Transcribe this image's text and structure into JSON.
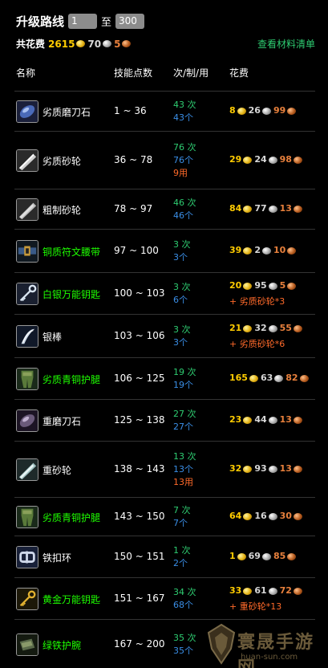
{
  "header": {
    "title": "升级路线",
    "from": "1",
    "to_label": "至",
    "to": "300"
  },
  "totals": {
    "label": "共花费",
    "gold": "2615",
    "silver": "70",
    "copper": "5"
  },
  "mats_link": "查看材料清单",
  "columns": {
    "name": "名称",
    "points": "技能点数",
    "times": "次/制/用",
    "cost": "花费"
  },
  "rows": [
    {
      "name": "劣质磨刀石",
      "name_green": false,
      "icon": "rough-sharpening-stone-icon",
      "range": "1 ~ 36",
      "t1": "43 次",
      "t2": "43个",
      "t3": "",
      "gold": "8",
      "silver": "26",
      "copper": "99",
      "extra": ""
    },
    {
      "name": "劣质砂轮",
      "name_green": false,
      "icon": "rough-grinding-stone-icon",
      "range": "36 ~ 78",
      "t1": "76 次",
      "t2": "76个",
      "t3": "9用",
      "gold": "29",
      "silver": "24",
      "copper": "98",
      "extra": ""
    },
    {
      "name": "粗制砂轮",
      "name_green": false,
      "icon": "coarse-grinding-stone-icon",
      "range": "78 ~ 97",
      "t1": "46 次",
      "t2": "46个",
      "t3": "",
      "gold": "84",
      "silver": "77",
      "copper": "13",
      "extra": ""
    },
    {
      "name": "铜质符文腰带",
      "name_green": true,
      "icon": "runed-copper-belt-icon",
      "range": "97 ~ 100",
      "t1": "3 次",
      "t2": "3个",
      "t3": "",
      "gold": "39",
      "silver": "2",
      "copper": "10",
      "extra": ""
    },
    {
      "name": "白银万能钥匙",
      "name_green": true,
      "icon": "silver-skeleton-key-icon",
      "range": "100 ~ 103",
      "t1": "3 次",
      "t2": "6个",
      "t3": "",
      "gold": "20",
      "silver": "95",
      "copper": "5",
      "extra": "+ 劣质砂轮*3"
    },
    {
      "name": "银棒",
      "name_green": false,
      "icon": "silver-rod-icon",
      "range": "103 ~ 106",
      "t1": "3 次",
      "t2": "3个",
      "t3": "",
      "gold": "21",
      "silver": "32",
      "copper": "55",
      "extra": "+ 劣质砂轮*6"
    },
    {
      "name": "劣质青铜护腿",
      "name_green": true,
      "icon": "rough-bronze-leggings-icon",
      "range": "106 ~ 125",
      "t1": "19 次",
      "t2": "19个",
      "t3": "",
      "gold": "165",
      "silver": "63",
      "copper": "82",
      "extra": ""
    },
    {
      "name": "重磨刀石",
      "name_green": false,
      "icon": "heavy-sharpening-stone-icon",
      "range": "125 ~ 138",
      "t1": "27 次",
      "t2": "27个",
      "t3": "",
      "gold": "23",
      "silver": "44",
      "copper": "13",
      "extra": ""
    },
    {
      "name": "重砂轮",
      "name_green": false,
      "icon": "heavy-grinding-stone-icon",
      "range": "138 ~ 143",
      "t1": "13 次",
      "t2": "13个",
      "t3": "13用",
      "gold": "32",
      "silver": "93",
      "copper": "13",
      "extra": ""
    },
    {
      "name": "劣质青铜护腿",
      "name_green": true,
      "icon": "rough-bronze-leggings-icon",
      "range": "143 ~ 150",
      "t1": "7 次",
      "t2": "7个",
      "t3": "",
      "gold": "64",
      "silver": "16",
      "copper": "30",
      "extra": ""
    },
    {
      "name": "铁扣环",
      "name_green": false,
      "icon": "iron-buckle-icon",
      "range": "150 ~ 151",
      "t1": "1 次",
      "t2": "2个",
      "t3": "",
      "gold": "1",
      "silver": "69",
      "copper": "85",
      "extra": ""
    },
    {
      "name": "黄金万能钥匙",
      "name_green": true,
      "icon": "golden-skeleton-key-icon",
      "range": "151 ~ 167",
      "t1": "34 次",
      "t2": "68个",
      "t3": "",
      "gold": "33",
      "silver": "61",
      "copper": "72",
      "extra": "+ 重砂轮*13"
    },
    {
      "name": "绿铁护腕",
      "name_green": true,
      "icon": "green-iron-bracers-icon",
      "range": "167 ~ 200",
      "t1": "35 次",
      "t2": "35个",
      "t3": "",
      "gold": "",
      "silver": "",
      "copper": "",
      "extra": ""
    }
  ],
  "watermark": {
    "cn": "寰晟手游网",
    "en": "huan-sun.com"
  }
}
